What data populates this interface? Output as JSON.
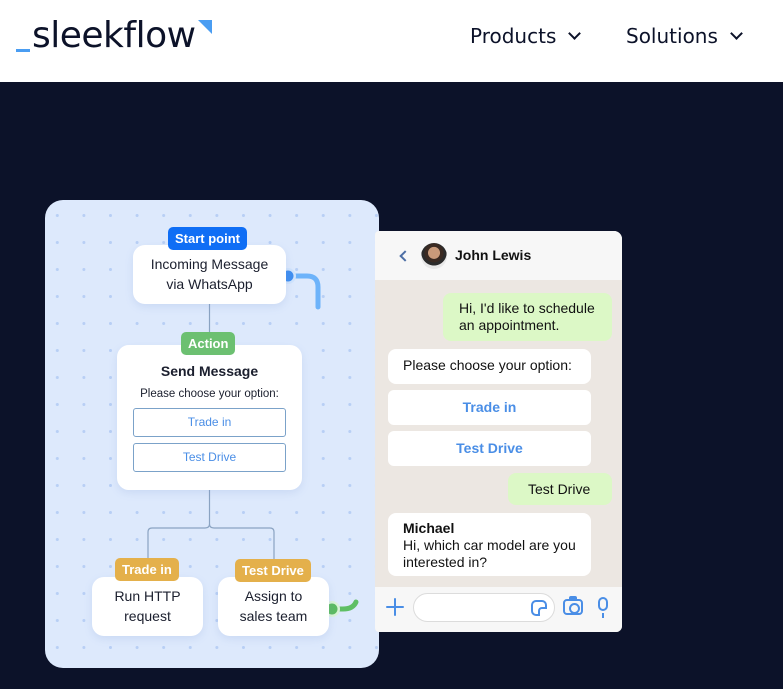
{
  "header": {
    "logo_text": "sleekflow",
    "nav": [
      {
        "label": "Products"
      },
      {
        "label": "Solutions"
      }
    ]
  },
  "flow": {
    "start": {
      "tag": "Start point",
      "line1": "Incoming Message",
      "line2": "via WhatsApp"
    },
    "action": {
      "tag": "Action",
      "title": "Send Message",
      "subtitle": "Please choose your option:",
      "options": [
        "Trade in",
        "Test Drive"
      ]
    },
    "branches": [
      {
        "tag": "Trade in",
        "line1": "Run HTTP",
        "line2": "request"
      },
      {
        "tag": "Test Drive",
        "line1": "Assign to",
        "line2": "sales team"
      }
    ]
  },
  "chat": {
    "contact_name": "John Lewis",
    "messages": [
      {
        "direction": "out",
        "line1": "Hi, I'd like to schedule",
        "line2": "an appointment."
      },
      {
        "direction": "in",
        "text": "Please choose your option:"
      },
      {
        "direction": "out",
        "text": "Test Drive"
      },
      {
        "direction": "in",
        "sender": "Michael",
        "line1": "Hi, which car model are you",
        "line2": "interested in?"
      }
    ],
    "quick_replies": [
      "Trade in",
      "Test Drive"
    ],
    "input_placeholder": ""
  },
  "colors": {
    "background": "#0c1229",
    "brand_blue": "#4a9df2",
    "start_pill": "#0f6ef5",
    "action_pill": "#6cc071",
    "branch_pill": "#e4b04b",
    "chat_out_bubble": "#dcf8c6",
    "link_blue": "#4a8ee6"
  }
}
